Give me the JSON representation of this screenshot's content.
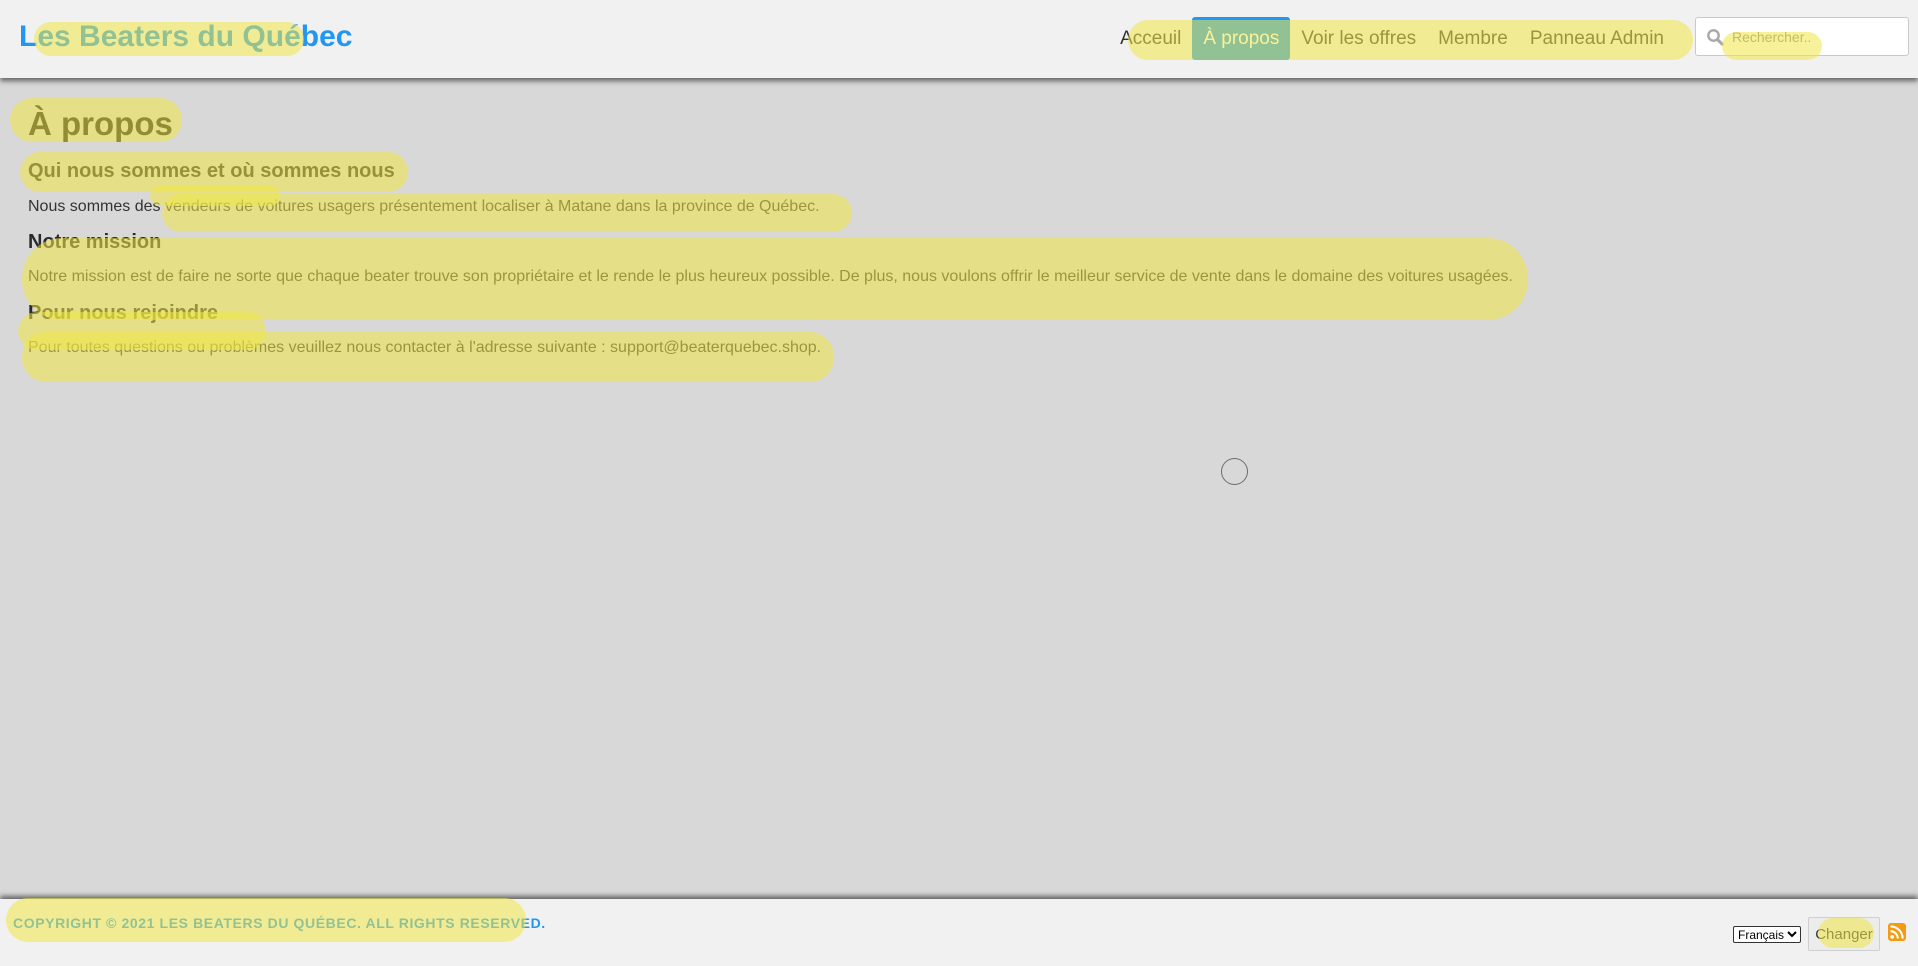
{
  "header": {
    "brand": "Les Beaters du Québec",
    "nav": [
      {
        "label": "Acceuil",
        "active": false
      },
      {
        "label": "À propos",
        "active": true
      },
      {
        "label": "Voir les offres",
        "active": false
      },
      {
        "label": "Membre",
        "active": false
      },
      {
        "label": "Panneau Admin",
        "active": false
      }
    ],
    "search": {
      "placeholder": "Rechercher..",
      "value": ""
    }
  },
  "main": {
    "title": "À propos",
    "sections": [
      {
        "heading": "Qui nous sommes et où sommes nous",
        "text": "Nous sommes des vendeurs de voitures usagers présentement localiser à Matane dans la province de Québec."
      },
      {
        "heading": "Notre mission",
        "text": "Notre mission est de faire ne sorte que chaque beater trouve son propriétaire et le rende le plus heureux possible. De plus, nous voulons offrir le meilleur service de vente dans le domaine des voitures usagées."
      },
      {
        "heading": "Pour nous rejoindre",
        "text": "Pour toutes questions ou problèmes veuillez nous contacter à l'adresse suivante : support@beaterquebec.shop."
      }
    ]
  },
  "footer": {
    "copyright": "COPYRIGHT © 2021 LES BEATERS DU QUÉBEC. ALL RIGHTS RESERVED.",
    "language_selected": "Français",
    "change_button": "Changer",
    "rss_icon": "rss-feed-icon"
  },
  "colors": {
    "accent": "#2196f3",
    "page_background": "#d8d8d8",
    "bar_background": "#f1f1f1",
    "rss": "#f49b16",
    "highlighter": "#f0e846"
  }
}
